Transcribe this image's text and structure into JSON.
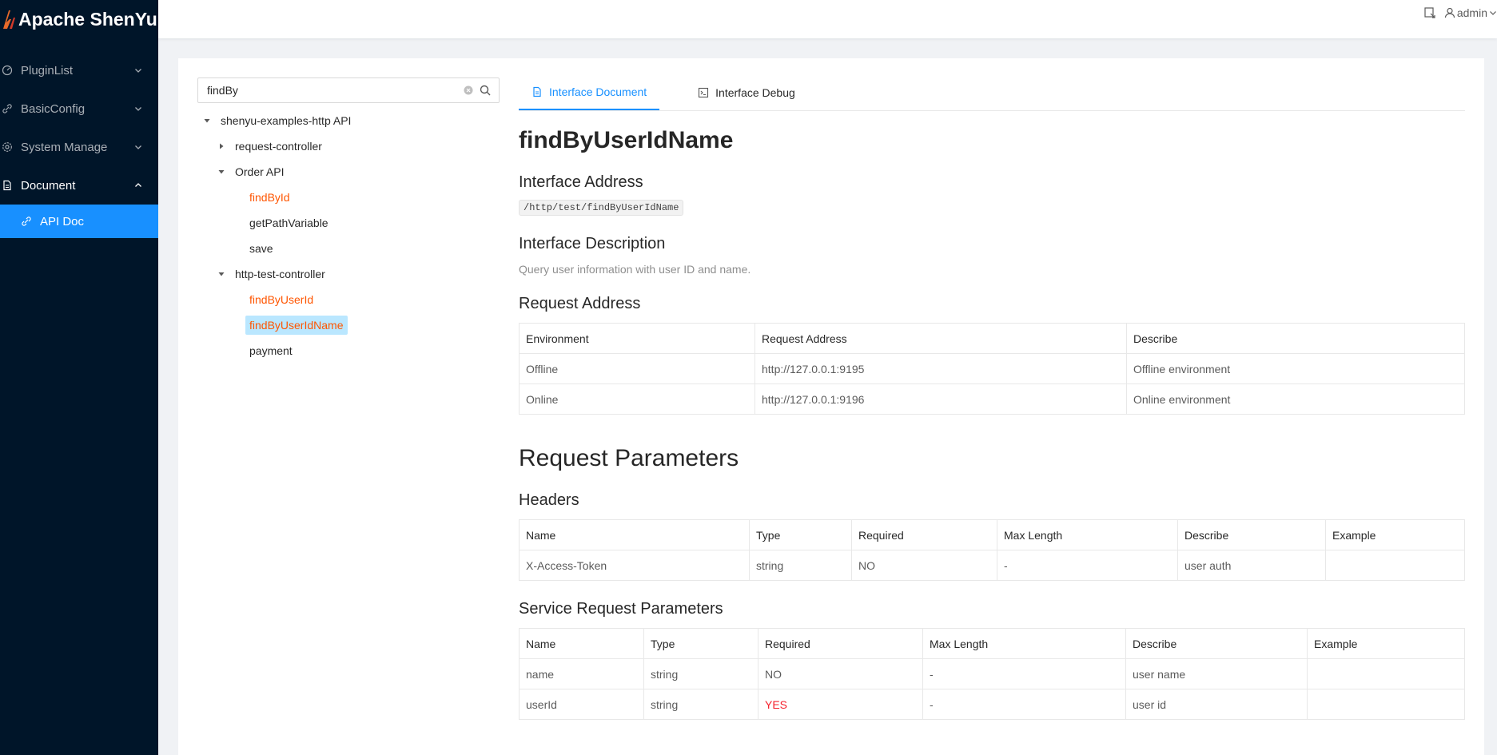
{
  "app": {
    "title": "Apache ShenYu"
  },
  "sidebar": {
    "items": [
      {
        "label": "PluginList",
        "icon": "dashboard-icon"
      },
      {
        "label": "BasicConfig",
        "icon": "link-icon"
      },
      {
        "label": "System Manage",
        "icon": "setting-icon"
      },
      {
        "label": "Document",
        "icon": "file-icon"
      }
    ],
    "sub_items": [
      {
        "label": "API Doc",
        "icon": "api-icon"
      }
    ]
  },
  "header": {
    "user": "admin"
  },
  "search": {
    "value": "findBy"
  },
  "tree": {
    "root": "shenyu-examples-http API",
    "groups": [
      {
        "label": "request-controller",
        "children": []
      },
      {
        "label": "Order API",
        "children": [
          "findById",
          "getPathVariable",
          "save"
        ]
      },
      {
        "label": "http-test-controller",
        "children": [
          "findByUserId",
          "findByUserIdName",
          "payment"
        ]
      }
    ]
  },
  "tabs": [
    {
      "label": "Interface Document"
    },
    {
      "label": "Interface Debug"
    }
  ],
  "doc": {
    "title": "findByUserIdName",
    "interface_address_heading": "Interface Address",
    "interface_address": "/http/test/findByUserIdName",
    "interface_description_heading": "Interface Description",
    "interface_description": "Query user information with user ID and name.",
    "request_address_heading": "Request Address",
    "request_address_table": {
      "headers": [
        "Environment",
        "Request Address",
        "Describe"
      ],
      "rows": [
        [
          "Offline",
          "http://127.0.0.1:9195",
          "Offline environment"
        ],
        [
          "Online",
          "http://127.0.0.1:9196",
          "Online environment"
        ]
      ]
    },
    "request_parameters_heading": "Request Parameters",
    "headers_heading": "Headers",
    "headers_table": {
      "headers": [
        "Name",
        "Type",
        "Required",
        "Max Length",
        "Describe",
        "Example"
      ],
      "rows": [
        [
          "X-Access-Token",
          "string",
          "NO",
          "-",
          "user auth",
          ""
        ]
      ]
    },
    "service_params_heading": "Service Request Parameters",
    "service_params_table": {
      "headers": [
        "Name",
        "Type",
        "Required",
        "Max Length",
        "Describe",
        "Example"
      ],
      "rows": [
        [
          "name",
          "string",
          "NO",
          "-",
          "user name",
          ""
        ],
        [
          "userId",
          "string",
          "YES",
          "-",
          "user id",
          ""
        ]
      ]
    }
  },
  "colors": {
    "sidebar_bg": "#001529",
    "primary": "#1890ff",
    "hit": "#ff5500",
    "selected_bg": "#bae7ff",
    "required_yes": "#f5222d"
  }
}
